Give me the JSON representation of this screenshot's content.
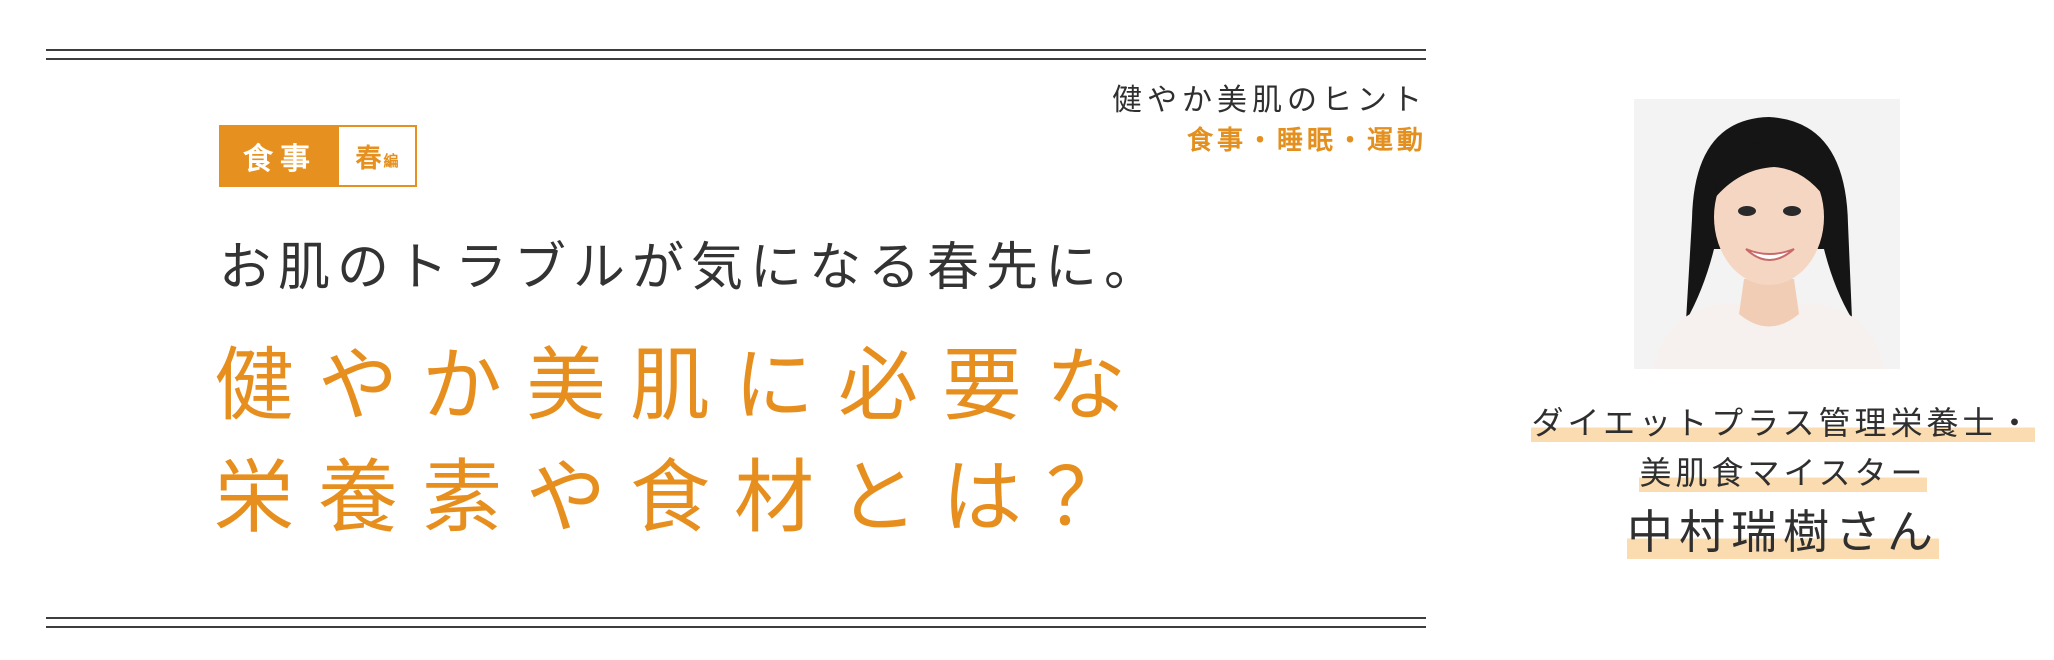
{
  "series": {
    "title": "健やか美肌のヒント",
    "subtitle": "食事・睡眠・運動"
  },
  "tag": {
    "main": "食事",
    "season": "春",
    "part": "編"
  },
  "lead": "お肌のトラブルが気になる春先に。",
  "headline": {
    "line1": "健やか美肌に必要な",
    "line2": "栄養素や食材とは？"
  },
  "profile": {
    "role_line1": "ダイエットプラス管理栄養士・",
    "role_line2": "美肌食マイスター",
    "name": "中村瑞樹さん"
  },
  "colors": {
    "accent": "#e5901f",
    "highlight": "#fbdcb0",
    "text": "#2f2f2f",
    "rule": "#3d3d3d"
  }
}
